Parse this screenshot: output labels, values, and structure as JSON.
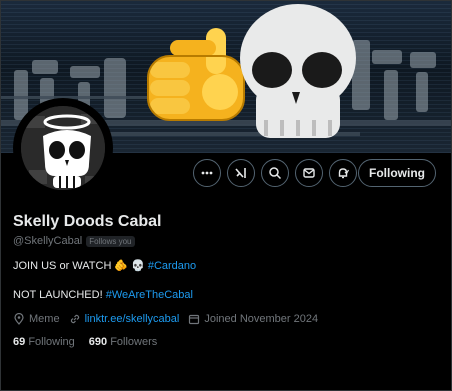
{
  "profile": {
    "name": "Skelly Doods Cabal",
    "handle": "@SkellyCabal",
    "follows_you_badge": "Follows you",
    "bio": {
      "line1_text": "JOIN US or WATCH",
      "line1_emojis": "🫵 💀",
      "line1_hashtag": "#Cardano",
      "line2_text": "NOT LAUNCHED!",
      "line2_hashtag": "#WeAreTheCabal"
    },
    "location": "Meme",
    "website": "linktr.ee/skellycabal",
    "joined": "Joined November 2024",
    "following_count": "69",
    "following_label": "Following",
    "followers_count": "690",
    "followers_label": "Followers"
  },
  "actions": {
    "follow_button_label": "Following",
    "icons": [
      "more-icon",
      "grok-icon",
      "search-icon",
      "message-icon",
      "notification-bell-icon"
    ]
  },
  "colors": {
    "background": "#000000",
    "text_primary": "#e7e9ea",
    "text_secondary": "#71767b",
    "link": "#1d9bf0",
    "border": "#536471"
  }
}
